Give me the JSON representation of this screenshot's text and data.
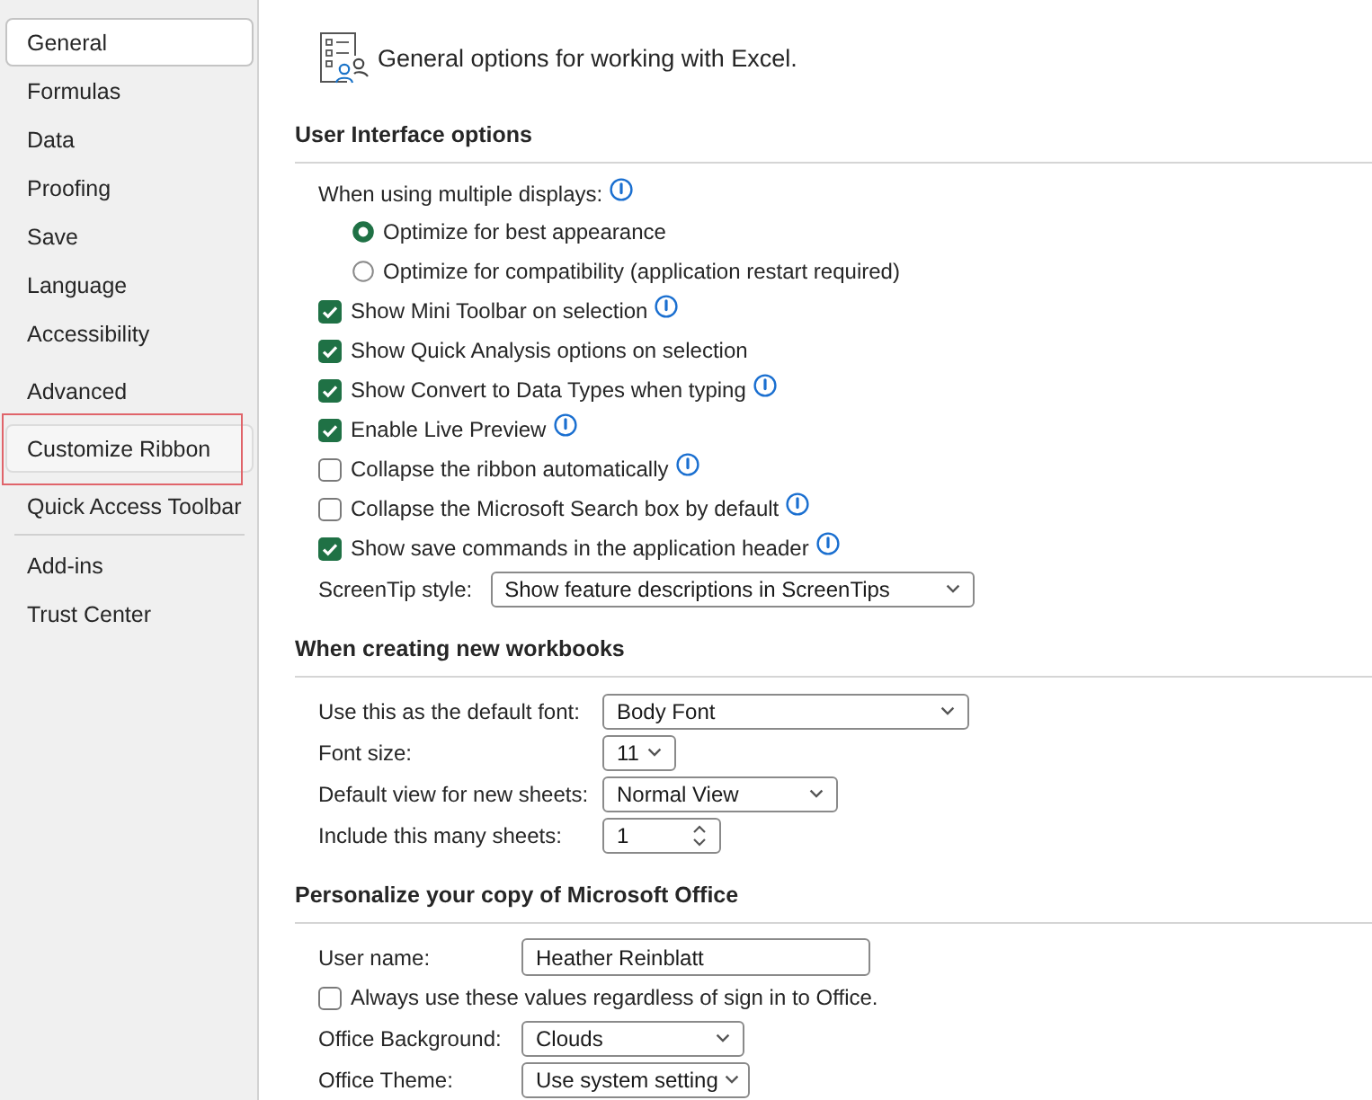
{
  "sidebar": {
    "groups": [
      {
        "separator": false,
        "items": [
          {
            "label": "General",
            "selected": true,
            "hovered": false,
            "highlighted": false
          },
          {
            "label": "Formulas",
            "selected": false,
            "hovered": false,
            "highlighted": false
          },
          {
            "label": "Data",
            "selected": false,
            "hovered": false,
            "highlighted": false
          },
          {
            "label": "Proofing",
            "selected": false,
            "hovered": false,
            "highlighted": false
          },
          {
            "label": "Save",
            "selected": false,
            "hovered": false,
            "highlighted": false
          },
          {
            "label": "Language",
            "selected": false,
            "hovered": false,
            "highlighted": false
          },
          {
            "label": "Accessibility",
            "selected": false,
            "hovered": false,
            "highlighted": false
          }
        ]
      },
      {
        "separator": false,
        "items": [
          {
            "label": "Advanced",
            "selected": false,
            "hovered": false,
            "highlighted": false
          },
          {
            "label": "Customize Ribbon",
            "selected": false,
            "hovered": true,
            "highlighted": true
          },
          {
            "label": "Quick Access Toolbar",
            "selected": false,
            "hovered": false,
            "highlighted": false
          }
        ]
      },
      {
        "separator": true,
        "items": [
          {
            "label": "Add-ins",
            "selected": false,
            "hovered": false,
            "highlighted": false
          },
          {
            "label": "Trust Center",
            "selected": false,
            "hovered": false,
            "highlighted": false
          }
        ]
      }
    ]
  },
  "header": {
    "title": "General options for working with Excel."
  },
  "sections": [
    {
      "heading": "User Interface options",
      "rows": [
        {
          "kind": "label",
          "label": "When using multiple displays:",
          "info": true
        },
        {
          "kind": "radio",
          "label": "Optimize for best appearance",
          "selected": true
        },
        {
          "kind": "radio",
          "label": "Optimize for compatibility (application restart required)",
          "selected": false
        },
        {
          "kind": "checkbox",
          "label": "Show Mini Toolbar on selection",
          "checked": true,
          "info": true
        },
        {
          "kind": "checkbox",
          "label": "Show Quick Analysis options on selection",
          "checked": true,
          "info": false
        },
        {
          "kind": "checkbox",
          "label": "Show Convert to Data Types when typing",
          "checked": true,
          "info": true
        },
        {
          "kind": "checkbox",
          "label": "Enable Live Preview",
          "checked": true,
          "info": true
        },
        {
          "kind": "checkbox",
          "label": "Collapse the ribbon automatically",
          "checked": false,
          "info": true
        },
        {
          "kind": "checkbox",
          "label": "Collapse the Microsoft Search box by default",
          "checked": false,
          "info": true
        },
        {
          "kind": "checkbox",
          "label": "Show save commands in the application header",
          "checked": true,
          "info": true
        },
        {
          "kind": "select",
          "label": "ScreenTip style:",
          "value": "Show feature descriptions in ScreenTips"
        }
      ]
    },
    {
      "heading": "When creating new workbooks",
      "rows": [
        {
          "kind": "select",
          "label": "Use this as the default font:",
          "value": "Body Font"
        },
        {
          "kind": "select",
          "label": "Font size:",
          "value": "11"
        },
        {
          "kind": "select",
          "label": "Default view for new sheets:",
          "value": "Normal View"
        },
        {
          "kind": "spinner",
          "label": "Include this many sheets:",
          "value": "1"
        }
      ]
    },
    {
      "heading": "Personalize your copy of Microsoft Office",
      "rows": [
        {
          "kind": "text",
          "label": "User name:",
          "value": "Heather Reinblatt"
        },
        {
          "kind": "checkbox",
          "label": "Always use these values regardless of sign in to Office.",
          "checked": false,
          "info": false
        },
        {
          "kind": "select",
          "label": "Office Background:",
          "value": "Clouds"
        },
        {
          "kind": "select",
          "label": "Office Theme:",
          "value": "Use system setting"
        }
      ]
    }
  ]
}
